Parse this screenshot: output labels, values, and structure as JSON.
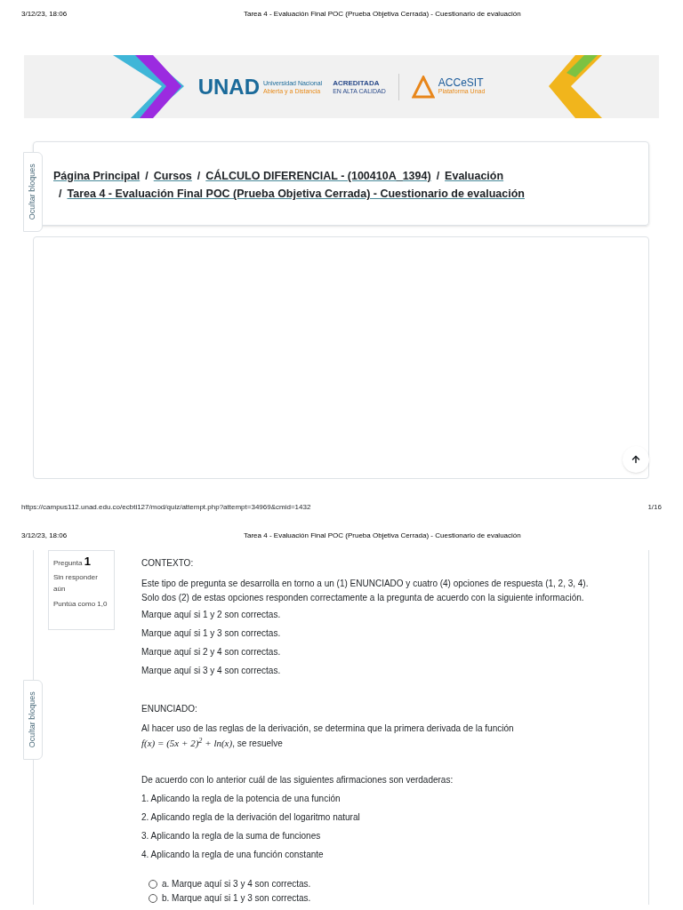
{
  "print_header": {
    "datetime": "3/12/23, 18:06",
    "title": "Tarea 4 - Evaluación Final POC (Prueba Objetiva Cerrada) - Cuestionario de evaluación"
  },
  "banner": {
    "logo_letters": "UNAD",
    "university_line1": "Universidad Nacional",
    "university_line2": "Abierta y a Distancia",
    "accredited": "ACREDITADA",
    "accredited_sub": "EN ALTA CALIDAD",
    "platform": "ACCeSIT",
    "platform_sub": "Plataforma Unad"
  },
  "blocks_toggle": "Ocultar bloques",
  "breadcrumb": {
    "separator": "/",
    "items": [
      {
        "label": "Página Principal"
      },
      {
        "label": "Cursos"
      },
      {
        "label": "CÁLCULO DIFERENCIAL - (100410A_1394)"
      },
      {
        "label": "Evaluación"
      },
      {
        "label": "Tarea 4 - Evaluación Final POC (Prueba Objetiva Cerrada) - Cuestionario de evaluación"
      }
    ]
  },
  "print_footer": {
    "url": "https://campus112.unad.edu.co/ecbti127/mod/quiz/attempt.php?attempt=34969&cmid=1432",
    "page": "1/16"
  },
  "print_header_2": {
    "datetime": "3/12/23, 18:06",
    "title": "Tarea 4 - Evaluación Final POC (Prueba Objetiva Cerrada) - Cuestionario de evaluación"
  },
  "blocks_toggle_2": "Ocultar bloques",
  "question_info": {
    "label": "Pregunta",
    "number": "1",
    "status": "Sin responder aún",
    "grade": "Puntúa como 1,0"
  },
  "question": {
    "context_title": "CONTEXTO:",
    "context_text": [
      "Este tipo de pregunta se desarrolla en torno a un (1) ENUNCIADO y cuatro (4) opciones de respuesta (1, 2, 3, 4).",
      "Solo dos (2) de estas opciones responden correctamente a la pregunta de acuerdo con la siguiente información."
    ],
    "keys": [
      "Marque aquí si 1 y 2 son correctas.",
      "Marque aquí si 1 y 3 son correctas.",
      "Marque aquí si 2 y 4 son correctas.",
      "Marque aquí si 3 y 4 son correctas."
    ],
    "statement_title": "ENUNCIADO:",
    "statement_text": "Al hacer uso de las reglas de la derivación, se determina que la primera derivada de la función",
    "formula": "f(x) = (5x + 2)$^{2}$ + ln(x)",
    "formula_tail": ", se resuelve",
    "prompt": "De acuerdo con lo anterior cuál de las siguientes afirmaciones son verdaderas:",
    "statements": [
      "1. Aplicando la regla de la potencia de una función",
      "2. Aplicando regla de la derivación del logaritmo natural",
      "3. Aplicando la regla de la suma de funciones",
      "4. Aplicando la regla de una función constante"
    ],
    "options": [
      {
        "label": "a. Marque aquí si 3 y 4 son correctas.",
        "selected": false
      },
      {
        "label": "b. Marque aquí si 1 y 3 son correctas.",
        "selected": false
      }
    ]
  }
}
